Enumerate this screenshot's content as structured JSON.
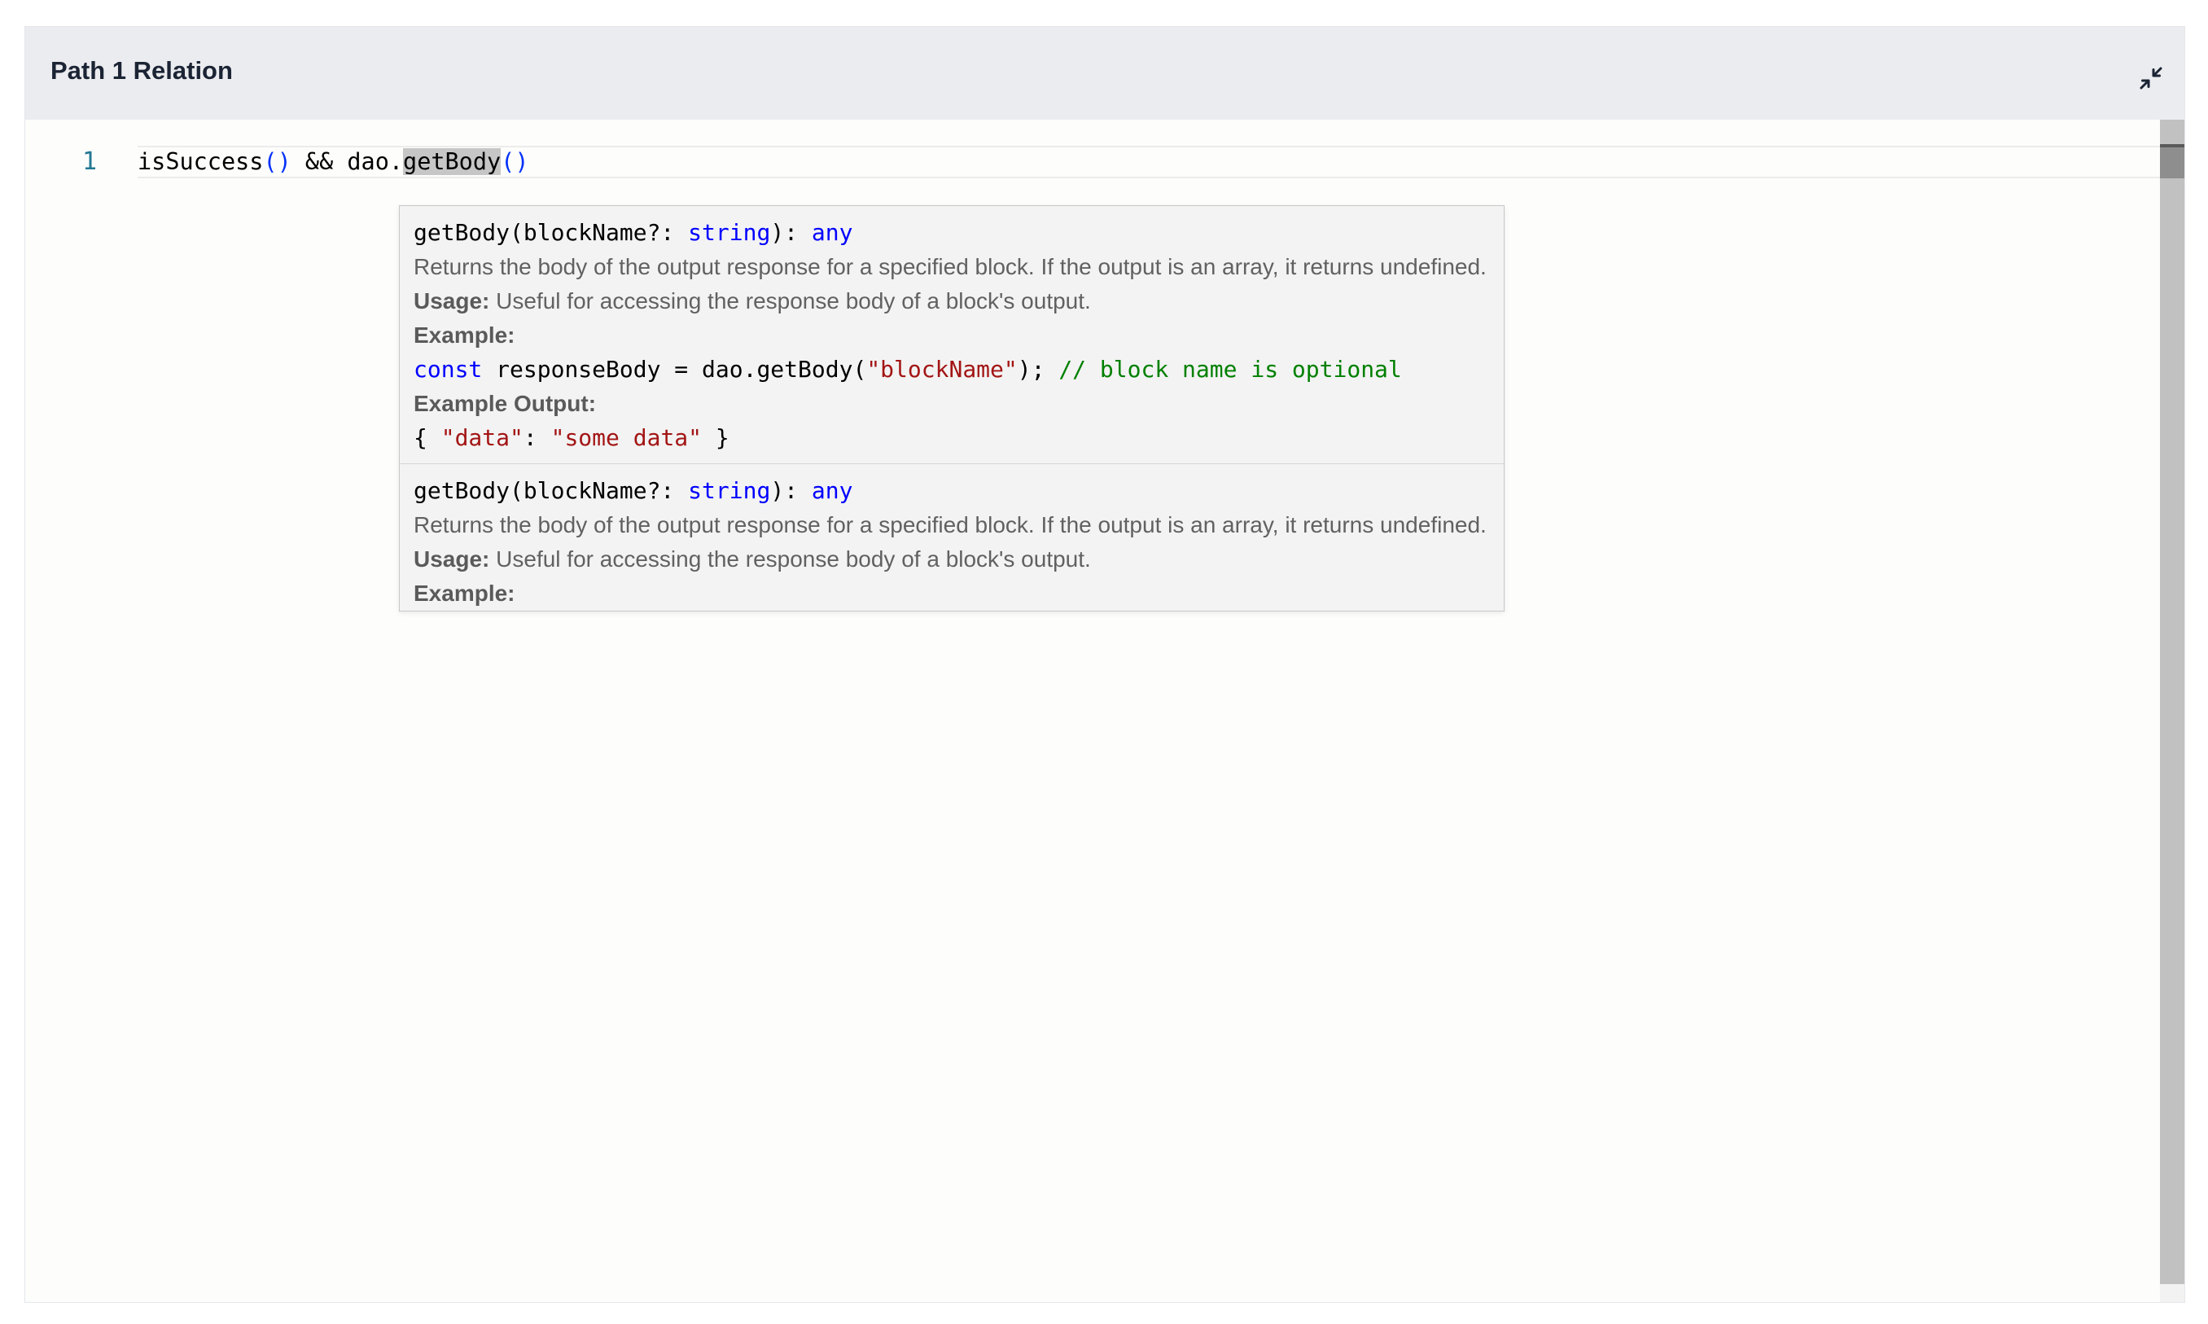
{
  "panel": {
    "title": "Path 1 Relation",
    "collapse_icon": "collapse-arrows-icon"
  },
  "editor": {
    "line_number": "1",
    "code": {
      "part1": "isSuccess",
      "paren1": "()",
      "part2": " && dao.",
      "highlight": "getBody",
      "paren2": "()"
    }
  },
  "hover": {
    "sections": [
      {
        "sig_name": "getBody(blockName?: ",
        "sig_type": "string",
        "sig_mid": "): ",
        "sig_ret": "any",
        "description": "Returns the body of the output response for a specified block. If the output is an array, it returns undefined.",
        "usage_label": "Usage:",
        "usage_text": " Useful for accessing the response body of a block's output.",
        "example_label": "Example:",
        "example_kw": "const",
        "example_mid": " responseBody = dao.getBody(",
        "example_str": "\"blockName\"",
        "example_end": "); ",
        "example_comment": "// block name is optional",
        "output_label": "Example Output:",
        "output_open": "{ ",
        "output_key": "\"data\"",
        "output_colon": ": ",
        "output_val": "\"some data\"",
        "output_close": " }"
      },
      {
        "sig_name": "getBody(blockName?: ",
        "sig_type": "string",
        "sig_mid": "): ",
        "sig_ret": "any",
        "description": "Returns the body of the output response for a specified block. If the output is an array, it returns undefined.",
        "usage_label": "Usage:",
        "usage_text": " Useful for accessing the response body of a block's output.",
        "example_label": "Example:"
      }
    ]
  }
}
